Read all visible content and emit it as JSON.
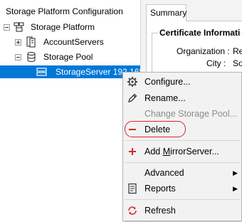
{
  "left_pane": {
    "header": "Storage Platform Configuration",
    "tree": {
      "root": "Storage Platform",
      "children": [
        {
          "label": "AccountServers",
          "expander": "+"
        },
        {
          "label": "Storage Pool",
          "expander": "-",
          "children": [
            {
              "label": "StorageServer 192.168"
            }
          ]
        }
      ]
    }
  },
  "right_pane": {
    "tab": "Summary",
    "group_title": "Certificate Informati",
    "fields": [
      {
        "label": "Organization :",
        "value": "Re"
      },
      {
        "label": "City :",
        "value": "So"
      }
    ]
  },
  "context_menu": {
    "items": [
      {
        "label": "Configure...",
        "icon": "gear-icon",
        "enabled": true
      },
      {
        "label": "Rename...",
        "icon": "pencil-icon",
        "enabled": true
      },
      {
        "label": "Change Storage Pool...",
        "icon": null,
        "enabled": false
      },
      {
        "label": "Delete",
        "icon": "minus-icon",
        "enabled": true,
        "highlighted": true
      },
      {
        "label": "Add MirrorServer...",
        "icon": "plus-icon",
        "enabled": true
      },
      {
        "label": "Advanced",
        "icon": null,
        "enabled": true,
        "submenu": true
      },
      {
        "label": "Reports",
        "icon": "report-icon",
        "enabled": true,
        "submenu": true
      },
      {
        "label": "Refresh",
        "icon": "refresh-icon",
        "enabled": true
      }
    ]
  },
  "colors": {
    "selection": "#0078d7",
    "delete_highlight": "#d9262a",
    "plus_icon": "#d9262a"
  }
}
